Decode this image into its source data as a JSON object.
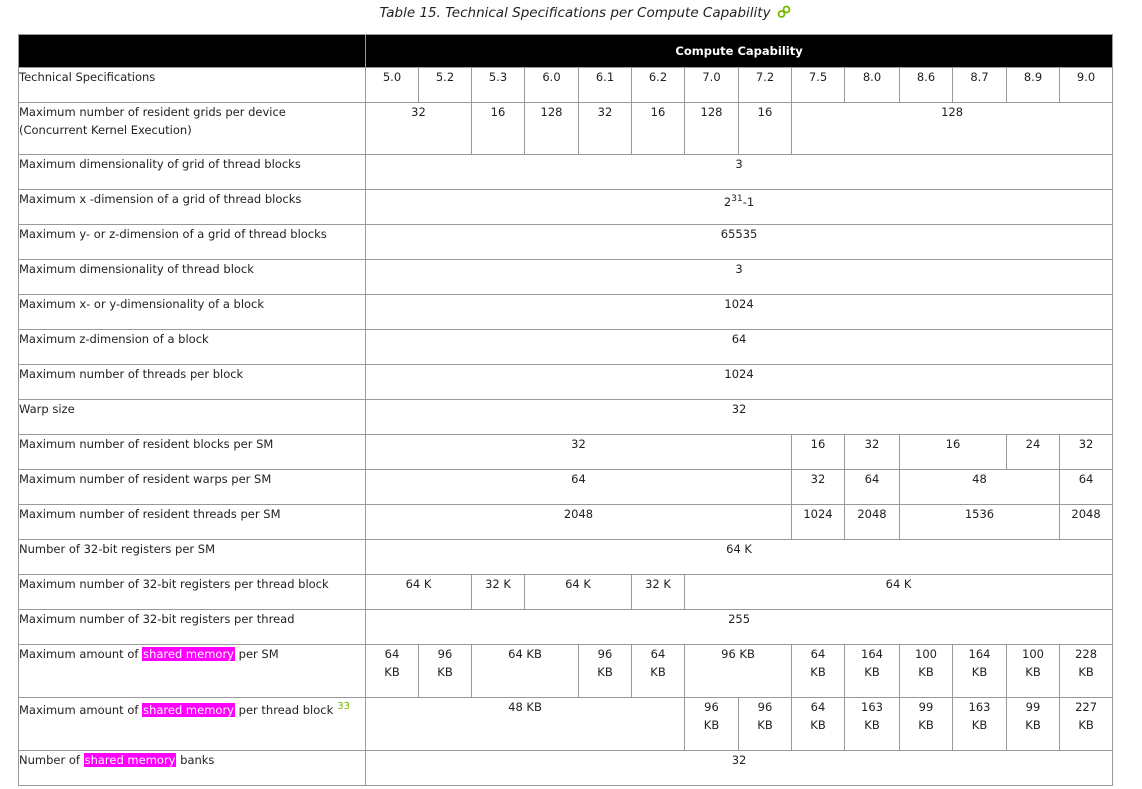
{
  "caption": "Table 15. Technical Specifications per Compute Capability",
  "header": {
    "compute_capability": "Compute Capability"
  },
  "colors": {
    "header_bg": "#000000",
    "highlight": "#ff00ff",
    "footnote": "#76b900"
  },
  "rows": {
    "tech": {
      "label": "Technical Specifications",
      "cells": [
        "5.0",
        "5.2",
        "5.3",
        "6.0",
        "6.1",
        "6.2",
        "7.0",
        "7.2",
        "7.5",
        "8.0",
        "8.6",
        "8.7",
        "8.9",
        "9.0"
      ]
    },
    "grids": {
      "label_line1": "Maximum number of resident grids per device",
      "label_line2": "(Concurrent Kernel Execution)",
      "cells": [
        "32",
        "16",
        "128",
        "32",
        "16",
        "128",
        "16",
        "128"
      ]
    },
    "grid_dim": {
      "label": "Maximum dimensionality of grid of thread blocks",
      "value": "3"
    },
    "x_dim": {
      "label": "Maximum x -dimension of a grid of thread blocks",
      "base": "2",
      "exp": "31",
      "suffix": "-1"
    },
    "yz_dim": {
      "label": "Maximum y- or z-dimension of a grid of thread blocks",
      "value": "65535"
    },
    "block_dim": {
      "label": "Maximum dimensionality of thread block",
      "value": "3"
    },
    "xy_block": {
      "label": "Maximum x- or y-dimensionality of a block",
      "value": "1024"
    },
    "z_block": {
      "label": "Maximum z-dimension of a block",
      "value": "64"
    },
    "threads_block": {
      "label": "Maximum number of threads per block",
      "value": "1024"
    },
    "warp": {
      "label": "Warp size",
      "value": "32"
    },
    "blocks_sm": {
      "label": "Maximum number of resident blocks per SM",
      "cells": [
        "32",
        "16",
        "32",
        "16",
        "24",
        "32"
      ]
    },
    "warps_sm": {
      "label": "Maximum number of resident warps per SM",
      "cells": [
        "64",
        "32",
        "64",
        "48",
        "64"
      ]
    },
    "threads_sm": {
      "label": "Maximum number of resident threads per SM",
      "cells": [
        "2048",
        "1024",
        "2048",
        "1536",
        "2048"
      ]
    },
    "regs_sm": {
      "label": "Number of 32-bit registers per SM",
      "value": "64 K"
    },
    "regs_block": {
      "label": "Maximum number of 32-bit registers per thread block",
      "cells": [
        "64 K",
        "32 K",
        "64 K",
        "32 K",
        "64 K"
      ]
    },
    "regs_thread": {
      "label": "Maximum number of 32-bit registers per thread",
      "value": "255"
    },
    "smem_sm": {
      "label_pre": "Maximum amount of",
      "label_hl": "shared memory",
      "label_post": "per SM",
      "cells": [
        [
          "64",
          "KB"
        ],
        [
          "96",
          "KB"
        ],
        [
          "64 KB"
        ],
        [
          "96",
          "KB"
        ],
        [
          "64",
          "KB"
        ],
        [
          "96 KB"
        ],
        [
          "64",
          "KB"
        ],
        [
          "164",
          "KB"
        ],
        [
          "100",
          "KB"
        ],
        [
          "164",
          "KB"
        ],
        [
          "100",
          "KB"
        ],
        [
          "228",
          "KB"
        ]
      ]
    },
    "smem_block": {
      "label_pre": "Maximum amount of",
      "label_hl": "shared memory",
      "label_post": "per thread block",
      "footnote": "33",
      "cells": [
        [
          "48 KB"
        ],
        [
          "96",
          "KB"
        ],
        [
          "96",
          "KB"
        ],
        [
          "64",
          "KB"
        ],
        [
          "163",
          "KB"
        ],
        [
          "99",
          "KB"
        ],
        [
          "163",
          "KB"
        ],
        [
          "99",
          "KB"
        ],
        [
          "227",
          "KB"
        ]
      ]
    },
    "banks": {
      "label_pre": "Number of",
      "label_hl": "shared memory",
      "label_post": "banks",
      "value": "32"
    }
  }
}
